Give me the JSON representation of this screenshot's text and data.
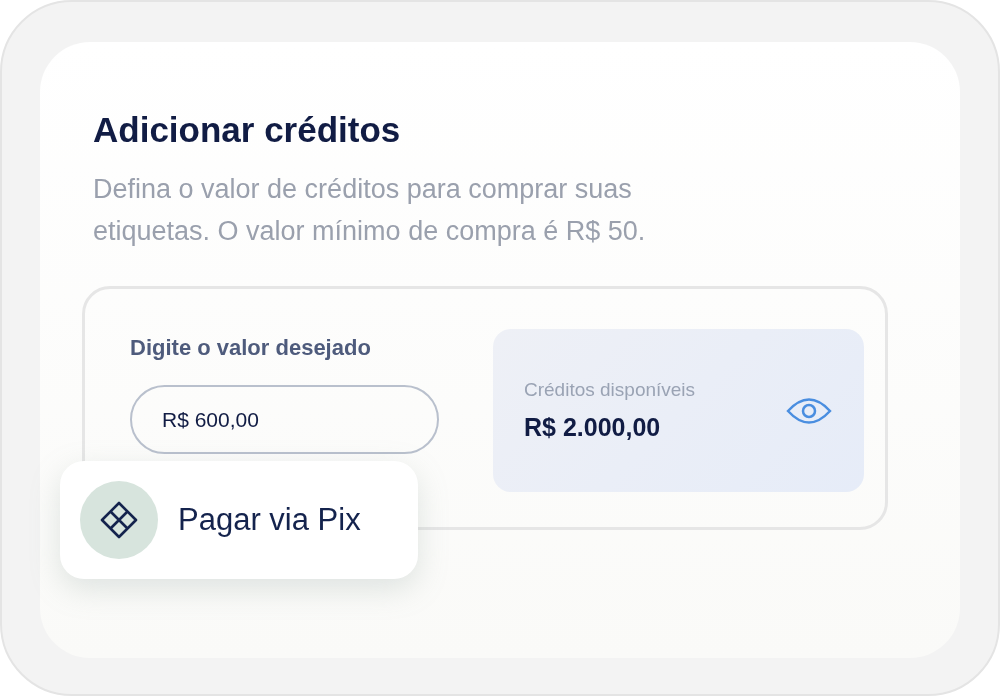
{
  "title": "Adicionar créditos",
  "description": "Defina o valor de créditos para comprar suas etiquetas. O valor mínimo de compra é R$ 50.",
  "amount": {
    "label": "Digite o valor desejado",
    "value": "R$ 600,00"
  },
  "balance": {
    "label": "Créditos disponíveis",
    "value": "R$ 2.000,00"
  },
  "pay_button": {
    "label": "Pagar via Pix"
  }
}
